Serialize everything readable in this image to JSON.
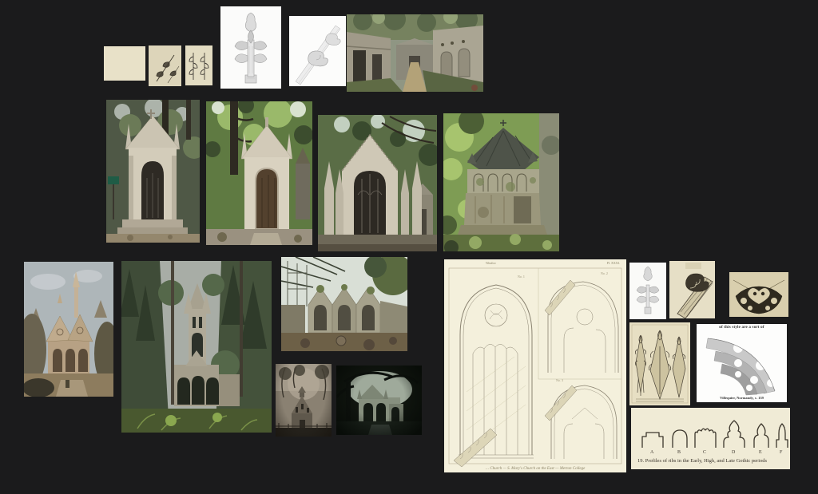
{
  "items": {
    "etch1": "Etched crocket studies",
    "etch2": "Etched crocket studies",
    "etch3": "Etched crocket studies",
    "finial_large": "Pencil drawing of a Gothic finial",
    "crockets_gable": "Pencil drawing of crockets on a gable",
    "avenue": "Cemetery avenue photo",
    "mausoleum1": "Gothic mausoleum chapel photo",
    "mausoleum2": "Gothic mausoleum chapel photo",
    "mausoleum3": "Gothic mausoleum facade photo",
    "mausoleum4": "Weathered Gothic mausoleum photo",
    "sepia_painting": "Sepia painting of a Gothic chapel",
    "forest_chapel": "Gothic chapel in forest photo",
    "ruins": "Gothic tomb arcade photo",
    "foggy_church": "Foggy church photo",
    "dark_mausoleum": "Dark mausoleum photo",
    "plate": "Gothic window tracery plate",
    "finial_small": "Finial drawing",
    "crocket_slope": "Crocket etching",
    "ornament": "Ornament etching",
    "pinnacles": "Pinnacles etching",
    "arch_fig": "Arch moldings figure",
    "rib_fig": "Rib profiles figure"
  },
  "plate": {
    "header_left": "Window",
    "header_right": "Pl. XXXI.",
    "label_1": "No. 1",
    "label_2": "No. 2",
    "label_3": "No. 3",
    "caption": "… Church — S. Mary's Church on the East — Merton College"
  },
  "arch_figure": {
    "top_text": "of this style are a sort of",
    "caption": "Villequier, Normandy, c. 139"
  },
  "rib_figure": {
    "letters": [
      "A",
      "B",
      "C",
      "D",
      "E",
      "F"
    ],
    "caption": "19.  Profiles of ribs in the Early, High, and Late Gothic periods"
  }
}
